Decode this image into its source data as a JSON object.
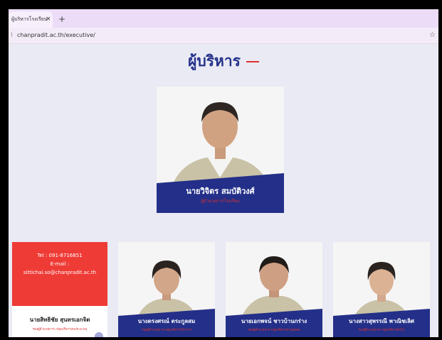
{
  "browser": {
    "tab_title": "ผู้บริหารโรงเรียน",
    "tab_close": "×",
    "new_tab": "+",
    "url": "chanpradit.ac.th/executive/"
  },
  "page": {
    "heading": "ผู้บริหาร"
  },
  "director": {
    "name": "นายวิจิตร สมบัติวงศ์",
    "role": "ผู้อำนวยการโรงเรียน"
  },
  "contact": {
    "tel": "Tel : 091-8716851",
    "email_label": "E-mail :",
    "email": "sittichai.so@chanpradit.ac.th",
    "name": "นายสิทธิชัย สุนทรเอกจิต",
    "role": "รองผู้อำนวยการ กลุ่มบริหารงบประมาณ"
  },
  "deputies": [
    {
      "name": "นางตรงศรณ์ ตระกูลสม",
      "role": "รองผู้อำนวยการ กลุ่มบริหารวิชาการ"
    },
    {
      "name": "นายเอกพจน์ ชาวบ้านกร่าง",
      "role": "รองผู้อำนวยการ กลุ่มบริหารงานบุคคล"
    },
    {
      "name": "นางสาวสุพรรณี พาณิชเลิศ",
      "role": "รองผู้อำนวยการ กลุ่มบริหารทั่วไป"
    }
  ],
  "colors": {
    "navy": "#24308a",
    "red": "#e0312e"
  },
  "icons": [
    "site-info-icon",
    "bookmark-star-icon"
  ]
}
